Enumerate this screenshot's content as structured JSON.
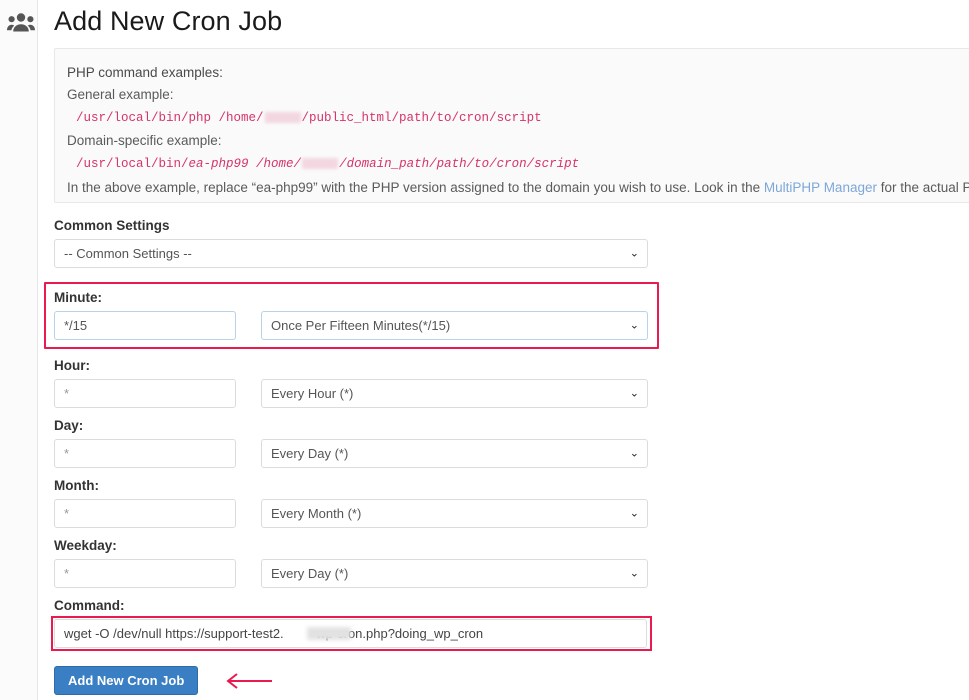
{
  "header": {
    "title": "Add New Cron Job",
    "icon": "users-group-icon"
  },
  "notice": {
    "heading": "PHP command examples:",
    "general_label": "General example:",
    "general_code_pre": "/usr/local/bin/php  /home/",
    "general_code_post": "/public_html/path/to/cron/script",
    "domain_label": "Domain-specific example:",
    "domain_code_pre": "/usr/local/bin/",
    "domain_code_ea": "ea-php99",
    "domain_code_mid": "  /home/",
    "domain_code_post": "/domain_path/path/to/cron/script",
    "footer_pre": "In the above example, replace “ea-php99” with the PHP version assigned to the domain you wish to use. Look in the ",
    "footer_link": "MultiPHP Manager",
    "footer_post": " for the actual PHP version as"
  },
  "form": {
    "common_settings": {
      "label": "Common Settings",
      "selected": "-- Common Settings --"
    },
    "minute": {
      "label": "Minute:",
      "value": "*/15",
      "selected": "Once Per Fifteen Minutes(*/15)"
    },
    "hour": {
      "label": "Hour:",
      "value": "*",
      "selected": "Every Hour (*)"
    },
    "day": {
      "label": "Day:",
      "value": "*",
      "selected": "Every Day (*)"
    },
    "month": {
      "label": "Month:",
      "value": "*",
      "selected": "Every Month (*)"
    },
    "weekday": {
      "label": "Weekday:",
      "value": "*",
      "selected": "Every Day (*)"
    },
    "command": {
      "label": "Command:",
      "value": "wget -O /dev/null https://support-test2.         wp-cron.php?doing_wp_cron"
    },
    "submit_label": "Add New Cron Job"
  },
  "icons": {
    "chevron_down": "⌄"
  },
  "colors": {
    "highlight": "#e81a4e",
    "button": "#3a7fc4",
    "code": "#d6336c",
    "link": "#7da7d9"
  }
}
